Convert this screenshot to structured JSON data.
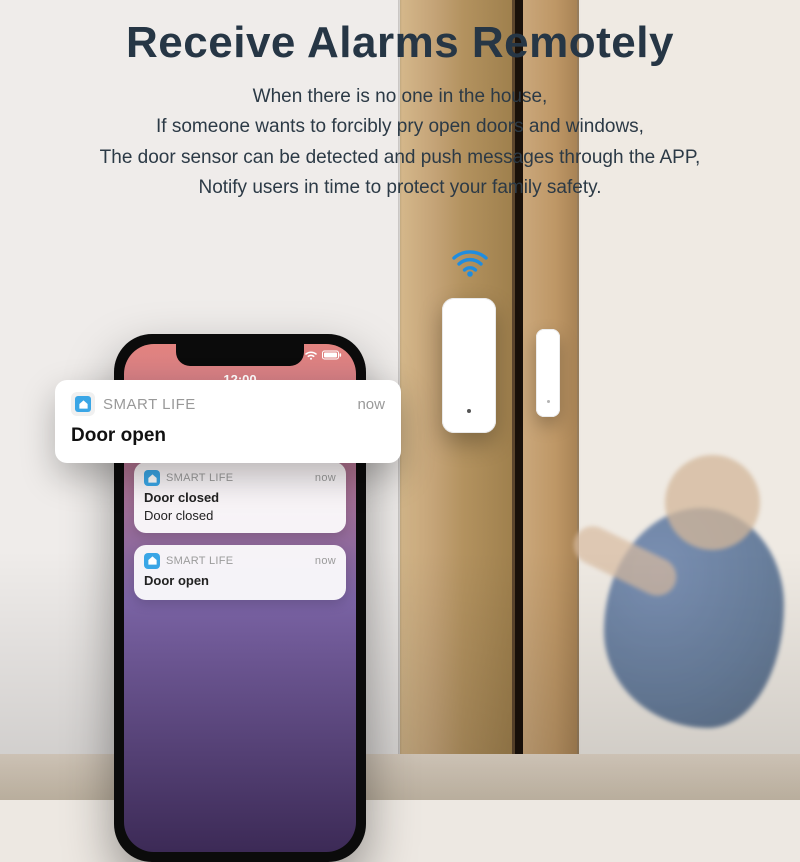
{
  "heading": {
    "title": "Receive Alarms Remotely",
    "lines": [
      "When there is no one in the house,",
      "If someone wants to forcibly pry open doors and windows,",
      "The door sensor can be detected and push messages through the APP,",
      "Notify users in time to protect your family safety."
    ]
  },
  "phone": {
    "status_time": "12:00",
    "notifications": [
      {
        "app": "SMART LIFE",
        "time": "now",
        "line1": "Door closed",
        "line2": "Door closed"
      },
      {
        "app": "SMART LIFE",
        "time": "now",
        "line1": "Door open",
        "line2": ""
      }
    ]
  },
  "popup": {
    "app": "SMART LIFE",
    "time": "now",
    "message": "Door open"
  },
  "icons": {
    "wifi": "wifi-icon",
    "app": "smart-life-app-icon"
  }
}
